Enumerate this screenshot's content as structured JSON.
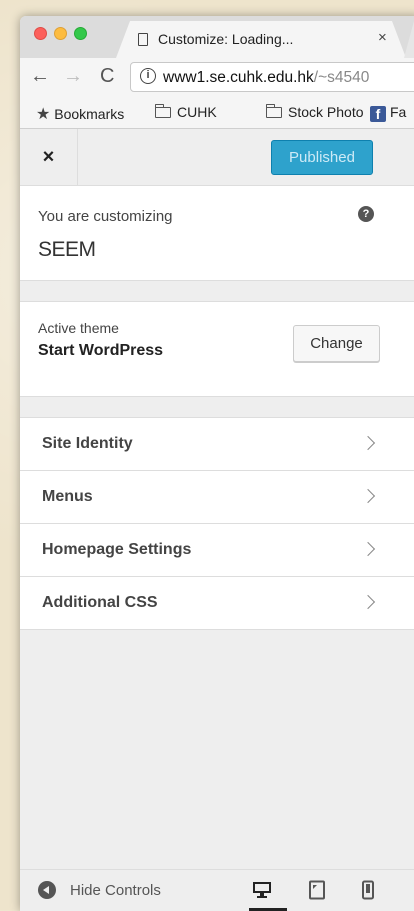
{
  "browser": {
    "tab_title": "Customize: Loading...",
    "tab_close": "×",
    "url_host": "www1.se.cuhk.edu.hk",
    "url_path": "/~s4540",
    "nav_back": "←",
    "nav_forward": "→",
    "nav_reload": "C",
    "bookmarks": [
      {
        "label": "Bookmarks",
        "icon": "star-icon"
      },
      {
        "label": "CUHK",
        "icon": "folder-icon"
      },
      {
        "label": "Stock Photo",
        "icon": "folder-icon"
      },
      {
        "label": "Fa",
        "icon": "facebook-icon"
      }
    ]
  },
  "customizer": {
    "close_label": "×",
    "publish_label": "Published",
    "customizing_label": "You are customizing",
    "site_name": "SEEM",
    "help_label": "?",
    "active_theme_label": "Active theme",
    "theme_name": "Start WordPress",
    "change_label": "Change",
    "sections": [
      {
        "label": "Site Identity"
      },
      {
        "label": "Menus"
      },
      {
        "label": "Homepage Settings"
      },
      {
        "label": "Additional CSS"
      }
    ],
    "footer": {
      "hide_controls_label": "Hide Controls",
      "devices": [
        "desktop",
        "tablet",
        "mobile"
      ],
      "selected_device": "desktop"
    }
  },
  "colors": {
    "publish_button": "#2ea2cc",
    "panel_bg": "#eeeeee"
  }
}
